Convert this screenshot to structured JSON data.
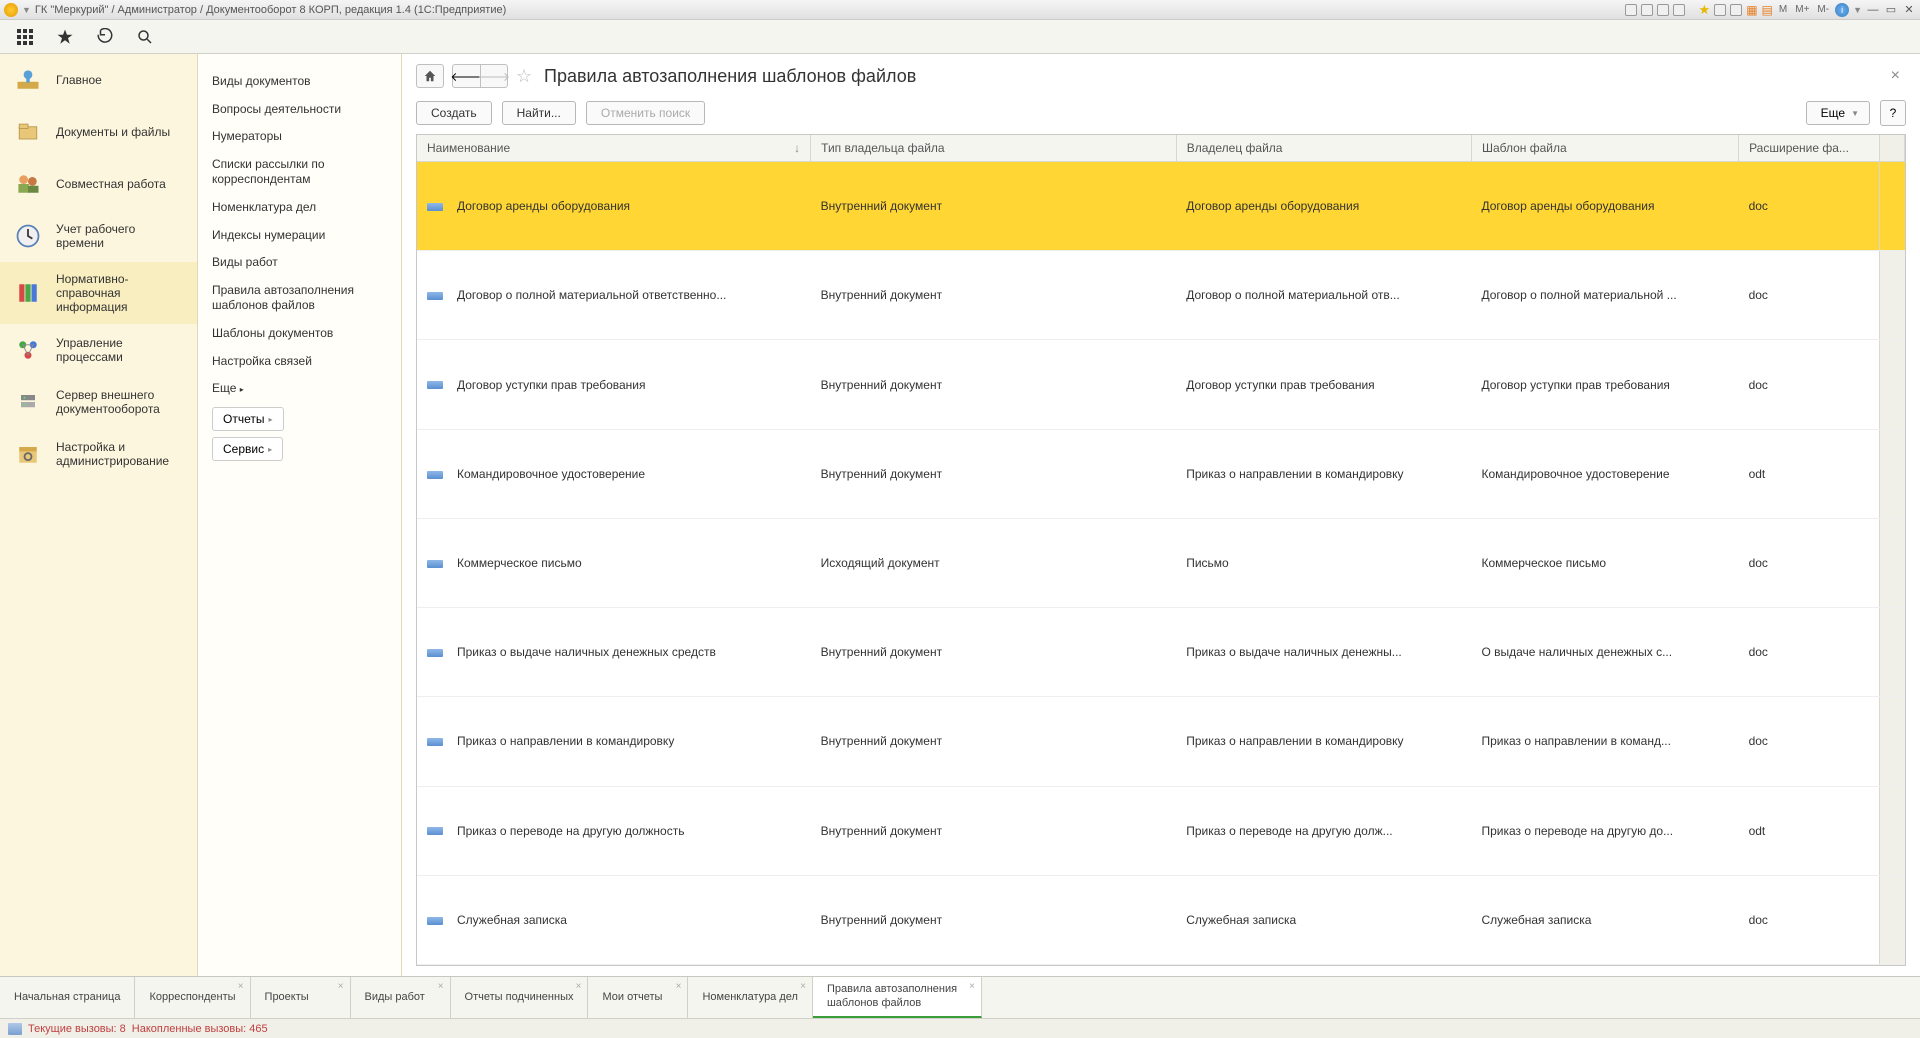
{
  "titlebar": {
    "title": "ГК \"Меркурий\" / Администратор / Документооборот 8 КОРП, редакция 1.4  (1С:Предприятие)",
    "m": "M",
    "mplus": "M+",
    "mminus": "M-"
  },
  "sidebar": {
    "items": [
      {
        "label": "Главное"
      },
      {
        "label": "Документы и файлы"
      },
      {
        "label": "Совместная работа"
      },
      {
        "label": "Учет рабочего времени"
      },
      {
        "label": "Нормативно-справочная информация"
      },
      {
        "label": "Управление процессами"
      },
      {
        "label": "Сервер внешнего документооборота"
      },
      {
        "label": "Настройка и администрирование"
      }
    ]
  },
  "subnav": {
    "links": [
      "Виды документов",
      "Вопросы деятельности",
      "Нумераторы",
      "Списки рассылки по корреспондентам",
      "Номенклатура дел",
      "Индексы нумерации",
      "Виды работ",
      "Правила автозаполнения шаблонов файлов",
      "Шаблоны документов",
      "Настройка связей"
    ],
    "more": "Еще",
    "reports": "Отчеты",
    "service": "Сервис"
  },
  "page": {
    "title": "Правила автозаполнения шаблонов файлов",
    "create": "Создать",
    "find": "Найти...",
    "cancel_search": "Отменить поиск",
    "more": "Еще",
    "help": "?"
  },
  "table": {
    "cols": [
      "Наименование",
      "Тип владельца файла",
      "Владелец файла",
      "Шаблон файла",
      "Расширение фа..."
    ],
    "rows": [
      {
        "name": "Договор аренды оборудования",
        "type": "Внутренний документ",
        "owner": "Договор аренды оборудования",
        "tpl": "Договор аренды оборудования",
        "ext": "doc",
        "selected": true
      },
      {
        "name": "Договор о полной материальной ответственно...",
        "type": "Внутренний документ",
        "owner": "Договор о полной материальной отв...",
        "tpl": "Договор о полной материальной ...",
        "ext": "doc"
      },
      {
        "name": "Договор уступки прав требования",
        "type": "Внутренний документ",
        "owner": "Договор уступки прав требования",
        "tpl": "Договор уступки прав требования",
        "ext": "doc"
      },
      {
        "name": "Командировочное удостоверение",
        "type": "Внутренний документ",
        "owner": "Приказ о направлении в командировку",
        "tpl": "Командировочное удостоверение",
        "ext": "odt"
      },
      {
        "name": "Коммерческое письмо",
        "type": "Исходящий документ",
        "owner": "Письмо",
        "tpl": "Коммерческое письмо",
        "ext": "doc"
      },
      {
        "name": "Приказ о выдаче наличных денежных средств",
        "type": "Внутренний документ",
        "owner": "Приказ о выдаче наличных денежны...",
        "tpl": "О выдаче наличных денежных с...",
        "ext": "doc"
      },
      {
        "name": "Приказ о направлении в командировку",
        "type": "Внутренний документ",
        "owner": "Приказ о направлении в командировку",
        "tpl": "Приказ о направлении в команд...",
        "ext": "doc"
      },
      {
        "name": "Приказ о переводе на другую должность",
        "type": "Внутренний документ",
        "owner": "Приказ о переводе на другую долж...",
        "tpl": "Приказ о переводе на другую до...",
        "ext": "odt"
      },
      {
        "name": "Служебная записка",
        "type": "Внутренний документ",
        "owner": "Служебная записка",
        "tpl": "Служебная записка",
        "ext": "doc"
      }
    ]
  },
  "bottom_tabs": [
    {
      "label": "Начальная страница",
      "closeable": false
    },
    {
      "label": "Корреспонденты",
      "closeable": true
    },
    {
      "label": "Проекты",
      "closeable": true
    },
    {
      "label": "Виды работ",
      "closeable": true
    },
    {
      "label": "Отчеты подчиненных",
      "closeable": true
    },
    {
      "label": "Мои отчеты",
      "closeable": true
    },
    {
      "label": "Номенклатура дел",
      "closeable": true
    },
    {
      "label": "Правила автозаполнения шаблонов файлов",
      "closeable": true,
      "active": true
    }
  ],
  "statusbar": {
    "calls": "Текущие вызовы: 8",
    "accumulated": "Накопленные вызовы: 465"
  }
}
